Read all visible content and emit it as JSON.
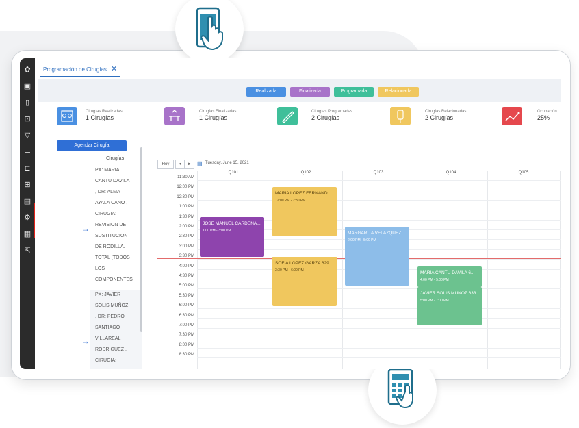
{
  "tab": {
    "label": "Programación de Cirugías",
    "close": "✕"
  },
  "legend": [
    {
      "label": "Realizada",
      "color": "#4a90e2"
    },
    {
      "label": "Finalizada",
      "color": "#a873c9"
    },
    {
      "label": "Programada",
      "color": "#3fbf9a"
    },
    {
      "label": "Relacionada",
      "color": "#f0c75e"
    }
  ],
  "cards": [
    {
      "title": "Cirugías Realizadas",
      "value": "1 Cirugías",
      "color": "#4a90e2",
      "icon": "operating-room-icon"
    },
    {
      "title": "Cirugías Finalizadas",
      "value": "1 Cirugías",
      "color": "#a873c9",
      "icon": "surgery-bed-icon"
    },
    {
      "title": "Cirugías Programadas",
      "value": "2 Cirugías",
      "color": "#3fbf9a",
      "icon": "scalpel-icon"
    },
    {
      "title": "Cirugías Relacionadas",
      "value": "2 Cirugías",
      "color": "#f0c75e",
      "icon": "iv-bag-icon"
    },
    {
      "title": "Ocupación",
      "value": "25%",
      "color": "#e5484d",
      "icon": "trend-line-icon"
    }
  ],
  "list": {
    "agendar": "Agendar Cirugía",
    "header": "Cirugías",
    "item1": [
      "PX: MARIA",
      "CANTU DAVILA",
      ", DR: ALMA",
      "AYALA CANO ,",
      "CIRUGIA:",
      "REVISION DE",
      "SUSTITUCION",
      "DE RODILLA.",
      "TOTAL (TODOS",
      "LOS",
      "COMPONENTES"
    ],
    "item2": [
      "PX: JAVIER",
      "SOLIS MUÑOZ",
      ", DR: PEDRO",
      "SANTIAGO",
      "VILLAREAL",
      "RODRIGUEZ ,",
      "CIRUGIA:"
    ]
  },
  "calendar": {
    "today": "Hoy",
    "prev": "◄",
    "next": "►",
    "date": "Tuesday, June 15, 2021",
    "columns": [
      "Q101",
      "Q102",
      "Q103",
      "Q104",
      "Q105"
    ],
    "times": [
      "11:30 AM",
      "12:00 PM",
      "12:30 PM",
      "1:00 PM",
      "1:30 PM",
      "2:00 PM",
      "2:30 PM",
      "3:00 PM",
      "3:30 PM",
      "4:00 PM",
      "4:30 PM",
      "5:00 PM",
      "5:30 PM",
      "6:00 PM",
      "6:30 PM",
      "7:00 PM",
      "7:30 PM",
      "8:00 PM",
      "8:30 PM"
    ],
    "events": [
      {
        "title": "JOSE MANUEL CARDENA...",
        "time": "1:00 PM - 3:00 PM",
        "color": "#8e44ad"
      },
      {
        "title": "MARIA LOPEZ FERNAND...",
        "time": "12:00 PM - 2:30 PM",
        "color": "#f0c75e"
      },
      {
        "title": "SOFIA LOPEZ GARZA 629",
        "time": "3:30 PM - 6:00 PM",
        "color": "#f0c75e"
      },
      {
        "title": "MARGARITA VELAZQUEZ...",
        "time": "2:00 PM - 5:00 PM",
        "color": "#8dbde9"
      },
      {
        "title": "MARIA CANTU DAVILA 6...",
        "time": "4:00 PM - 5:00 PM",
        "color": "#6cc28f"
      },
      {
        "title": "JAVIER SOLIS MUÑOZ 633",
        "time": "5:00 PM - 7:00 PM",
        "color": "#6cc28f"
      }
    ]
  }
}
